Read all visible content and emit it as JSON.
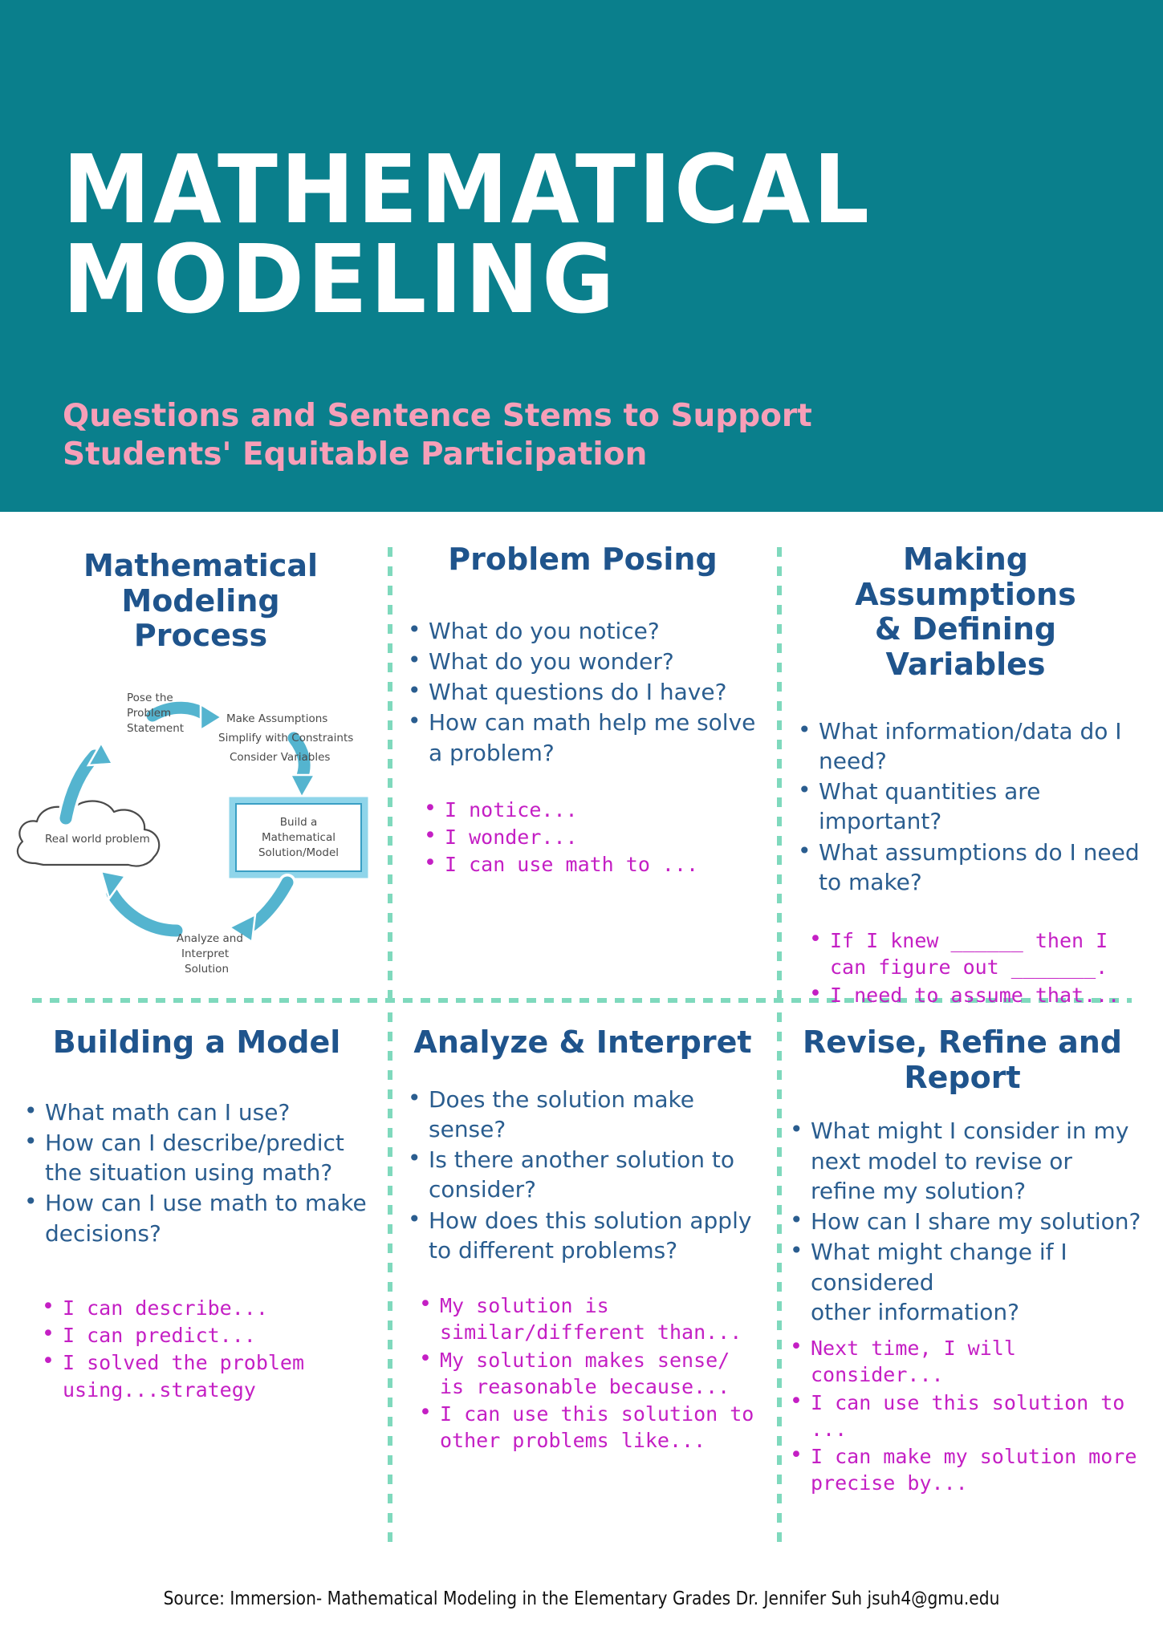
{
  "header": {
    "title": "MATHEMATICAL\nMODELING",
    "subtitle": "Questions and Sentence Stems to Support\nStudents' Equitable Participation",
    "background_color": "#0a7f8c",
    "title_color": "#ffffff",
    "subtitle_color": "#f79fb8"
  },
  "colors": {
    "teal": "#0a7f8c",
    "pink": "#f79fb8",
    "heading_blue": "#1f548c",
    "body_blue": "#2a5d8f",
    "stem_magenta": "#c41fc4",
    "divider_mint": "#7fd9bd",
    "diagram_blue": "#54b4cf"
  },
  "panels": [
    {
      "id": "process",
      "heading": "Mathematical\nModeling\nProcess",
      "questions": [],
      "stems": []
    },
    {
      "id": "problem-posing",
      "heading": "Problem Posing",
      "questions": [
        "What do you notice?",
        "What do you wonder?",
        "What questions do I have?",
        "How can math help me solve a problem?"
      ],
      "stems": [
        "I notice...",
        "I wonder...",
        "I can use math to ..."
      ]
    },
    {
      "id": "assumptions-variables",
      "heading": "Making Assumptions\n& Defining Variables",
      "questions": [
        "What information/data do I  need?",
        "What quantities are important?",
        "What assumptions do I need to make?"
      ],
      "stems": [
        "If I knew ______ then I can figure out _______.",
        "I need to assume that..."
      ]
    },
    {
      "id": "building-a-model",
      "heading": "Building a Model",
      "questions": [
        "What math can I use?",
        "How can I describe/predict the situation using math?",
        "How can I use math to make decisions?"
      ],
      "stems": [
        "I can describe...",
        "I can predict...",
        "I solved the problem using...strategy"
      ]
    },
    {
      "id": "analyze-interpret",
      "heading": "Analyze & Interpret",
      "questions": [
        "Does the solution make sense?",
        "Is there another solution to consider?",
        "How does this solution apply to different problems?"
      ],
      "stems": [
        "My solution is similar/different than...",
        "My solution makes sense/ is reasonable because...",
        "I can use this solution to other problems like..."
      ]
    },
    {
      "id": "revise-refine-report",
      "heading": "Revise, Refine and\nReport",
      "questions": [
        "What might I consider in my next model to revise or refine my solution?",
        "How can I share my solution?",
        "What might change if I considered\nother information?"
      ],
      "stems": [
        "Next time, I will consider...",
        "I can use this solution to ...",
        "I can make my solution more precise by..."
      ]
    }
  ],
  "diagram": {
    "labels": {
      "pose": "Pose the\nProblem\nStatement",
      "assumptions": "Make Assumptions\nSimplify with Constraints\nConsider Variables",
      "build": "Build a\nMathematical\nSolution/Model",
      "analyze": "Analyze and\nInterpret\nSolution",
      "cloud": "Real world problem"
    }
  },
  "footer": {
    "text": "Source: Immersion- Mathematical Modeling in the Elementary Grades  Dr. Jennifer Suh jsuh4@gmu.edu"
  }
}
